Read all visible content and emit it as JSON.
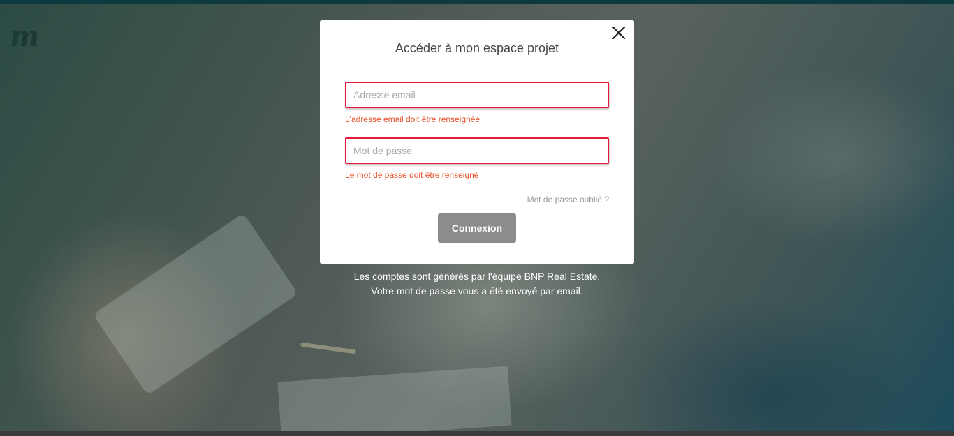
{
  "logo": {
    "letter": "m",
    "color": "#1c3a35"
  },
  "modal": {
    "title": "Accéder à mon espace projet",
    "close_icon": "close-icon",
    "email": {
      "placeholder": "Adresse email",
      "value": "",
      "error": "L'adresse email doit être renseignée"
    },
    "password": {
      "placeholder": "Mot de passe",
      "value": "",
      "error": "Le mot de passe doit être renseigné"
    },
    "forgot_link": "Mot de passe oublié ?",
    "submit_label": "Connexion"
  },
  "info": {
    "line1": "Les comptes sont générés par l'équipe BNP Real Estate.",
    "line2": "Votre mot de passe vous a été envoyé par email."
  },
  "colors": {
    "error_border": "#e8193b",
    "error_text": "#e8512a",
    "button_bg": "#8c8c8c",
    "topbar": "#0d3a3f"
  }
}
